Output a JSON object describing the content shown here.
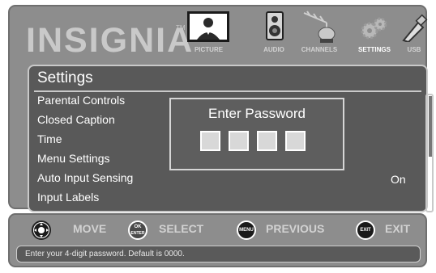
{
  "brand": {
    "logo": "INSIGNIA",
    "tm": "TM"
  },
  "menu_tabs": [
    {
      "label": "PICTURE",
      "icon": "picture-icon"
    },
    {
      "label": "AUDIO",
      "icon": "speaker-icon"
    },
    {
      "label": "CHANNELS",
      "icon": "satellite-antenna-icon"
    },
    {
      "label": "SETTINGS",
      "icon": "gears-icon",
      "active": true
    },
    {
      "label": "USB",
      "icon": "usb-drive-icon"
    }
  ],
  "settings": {
    "title": "Settings",
    "items": [
      {
        "label": "Parental Controls"
      },
      {
        "label": "Closed Caption"
      },
      {
        "label": "Time"
      },
      {
        "label": "Menu Settings"
      },
      {
        "label": "Auto Input Sensing",
        "value": "On"
      },
      {
        "label": "Input Labels"
      }
    ]
  },
  "password_dialog": {
    "title": "Enter Password",
    "digit_count": 4
  },
  "navigation": {
    "move": {
      "label": "MOVE",
      "icon": "dpad-icon"
    },
    "select": {
      "label": "SELECT",
      "icon_text_top": "OK",
      "icon_text_bottom": "ENTER"
    },
    "previous": {
      "label": "PREVIOUS",
      "icon_text": "MENU"
    },
    "exit": {
      "label": "EXIT",
      "icon_text": "EXIT"
    }
  },
  "hint": "Enter your 4-digit password. Default is 0000.",
  "colors": {
    "panel": "#8d8d8d",
    "content": "#595959",
    "accent": "#ffffff"
  }
}
